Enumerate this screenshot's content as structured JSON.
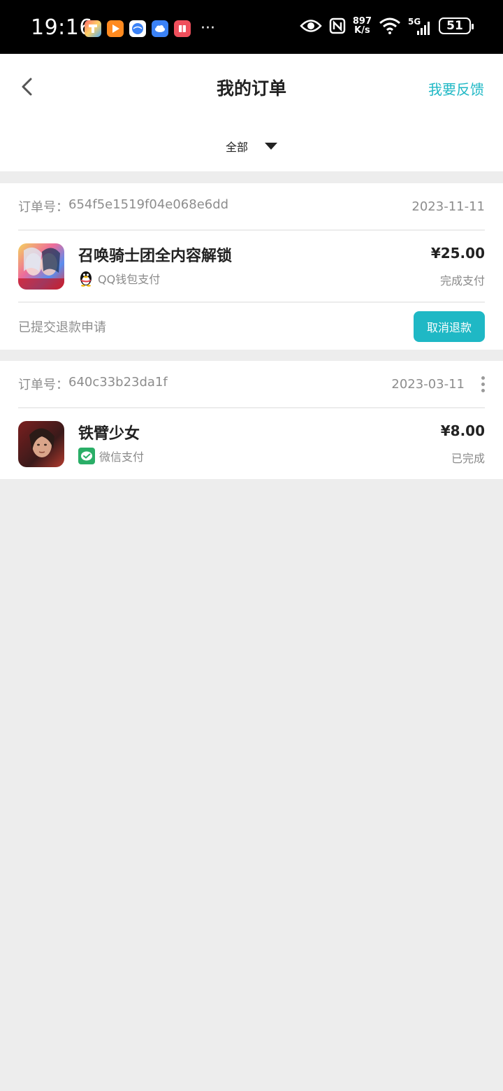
{
  "status_bar": {
    "time": "19:16",
    "more": "···",
    "speed_top": "897",
    "speed_bottom": "K/s",
    "network": "5G",
    "battery": "51"
  },
  "header": {
    "title": "我的订单",
    "feedback": "我要反馈",
    "filter": "全部"
  },
  "orders": [
    {
      "label": "订单号：",
      "number": "654f5e1519f04e068e6dd",
      "date": "2023-11-11",
      "title": "召唤骑士团全内容解锁",
      "payment": "QQ钱包支付",
      "price": "¥25.00",
      "state": "完成支付",
      "footer_text": "已提交退款申请",
      "action": "取消退款"
    },
    {
      "label": "订单号：",
      "number": "640c33b23da1f",
      "date": "2023-03-11",
      "title": "铁臂少女",
      "payment": "微信支付",
      "price": "¥8.00",
      "state": "已完成"
    }
  ],
  "colors": {
    "accent": "#1fb8c5",
    "background": "#ededed",
    "wechat": "#2aae67"
  }
}
